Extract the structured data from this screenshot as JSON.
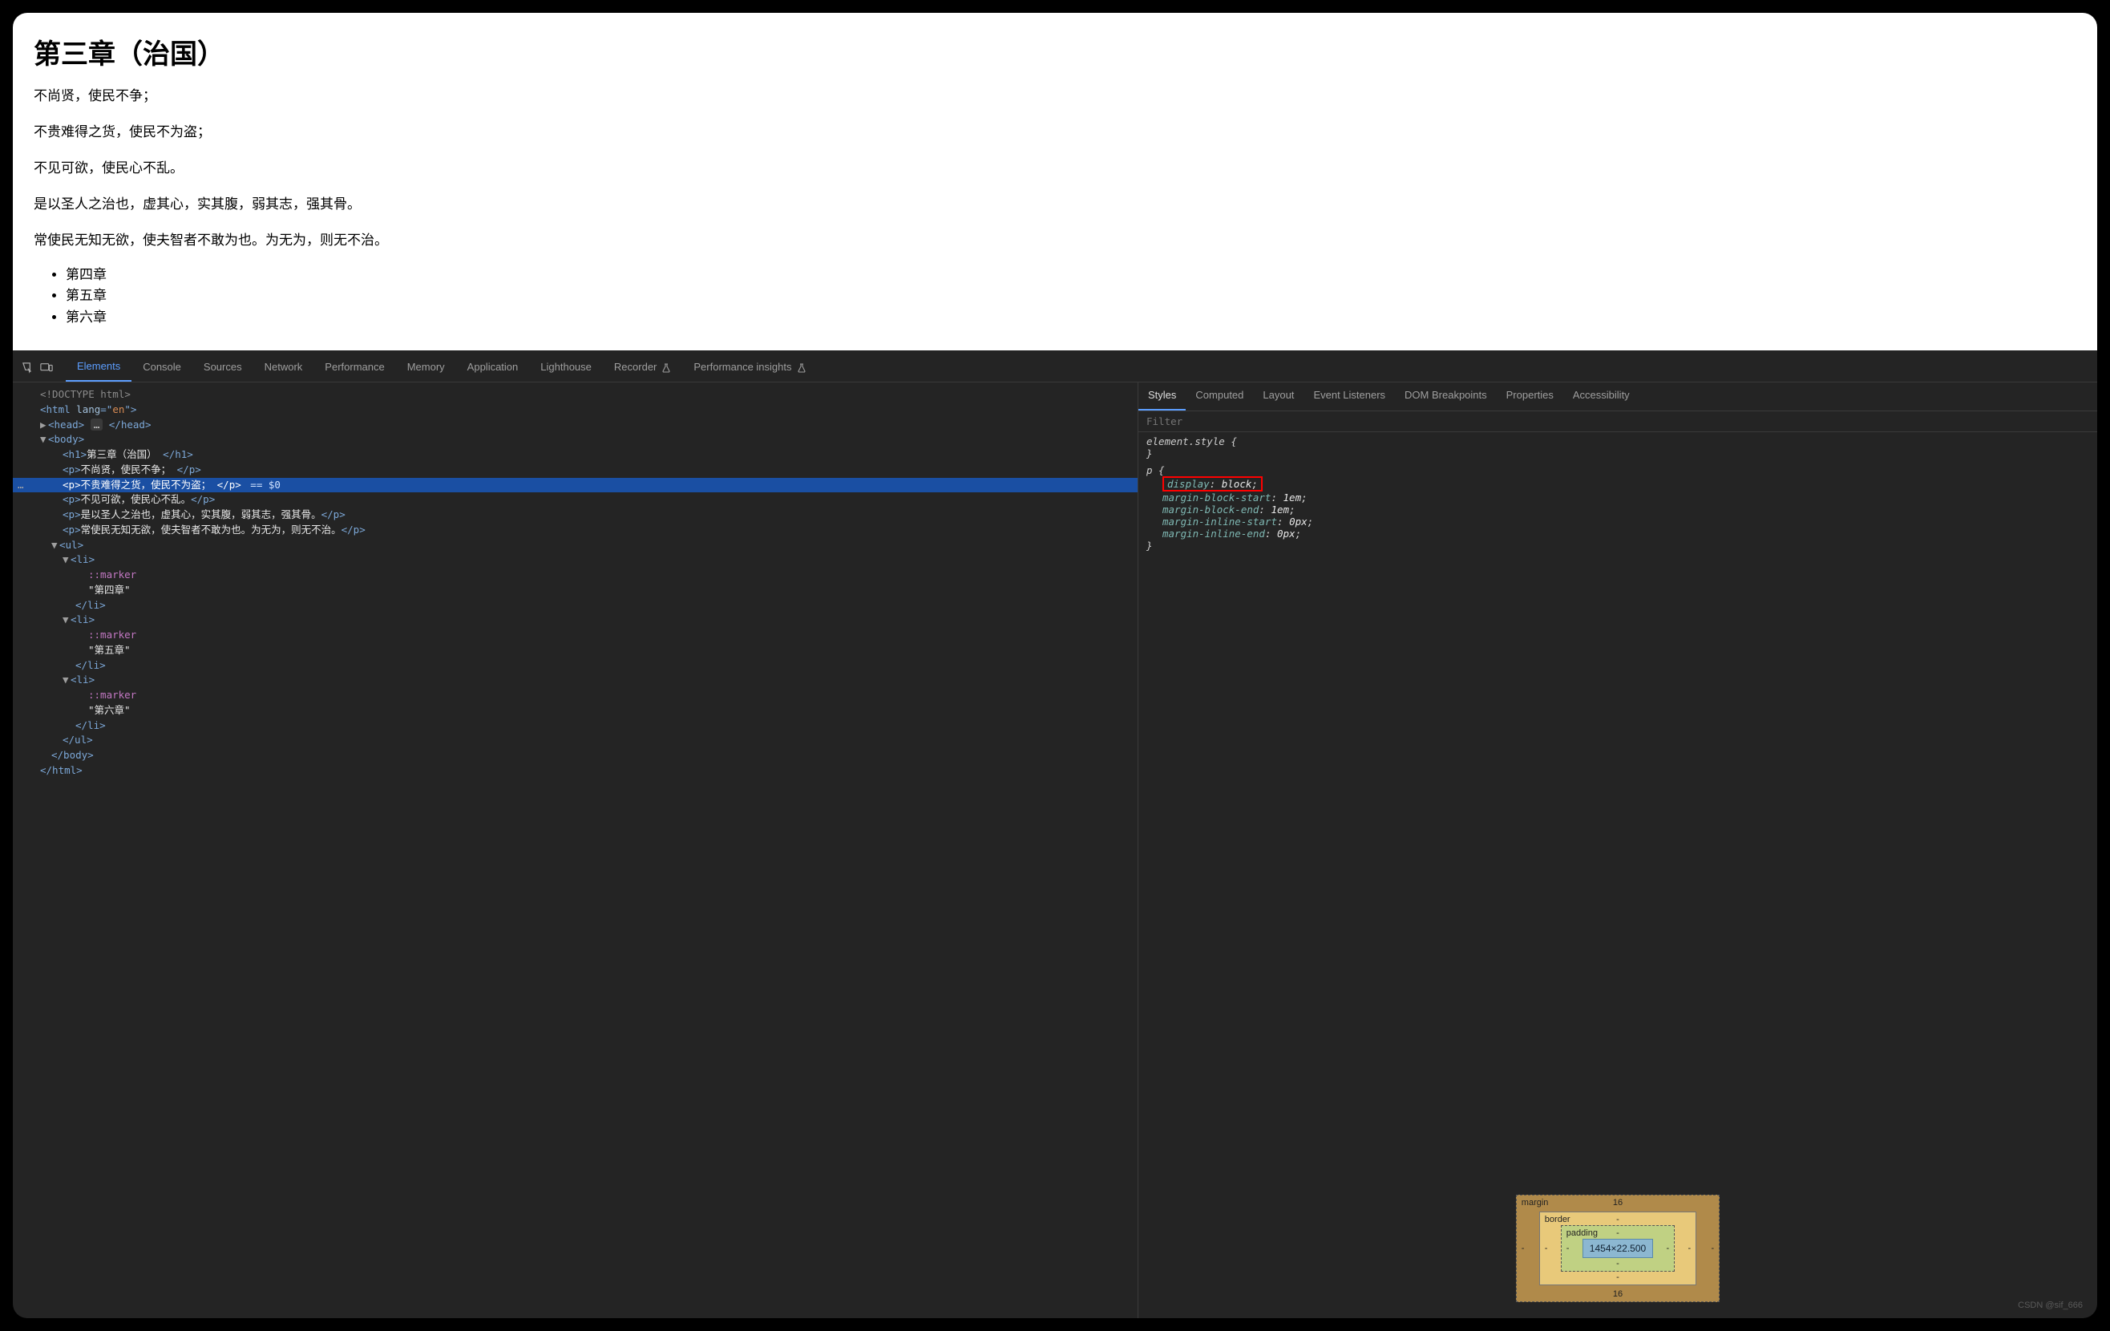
{
  "page": {
    "title": "第三章（治国）",
    "paragraphs": [
      "不尚贤，使民不争；",
      "不贵难得之货，使民不为盗；",
      "不见可欲，使民心不乱。",
      "是以圣人之治也，虚其心，实其腹，弱其志，强其骨。",
      "常使民无知无欲，使夫智者不敢为也。为无为，则无不治。"
    ],
    "list": [
      "第四章",
      "第五章",
      "第六章"
    ]
  },
  "devtools": {
    "tabs": [
      "Elements",
      "Console",
      "Sources",
      "Network",
      "Performance",
      "Memory",
      "Application",
      "Lighthouse",
      "Recorder",
      "Performance insights"
    ],
    "activeTab": "Elements",
    "tree": {
      "doctype": "<!DOCTYPE html>",
      "html_open": "html",
      "lang_attr": "lang",
      "lang_val": "en",
      "head_open": "head",
      "head_ellipsis": "…",
      "head_close": "/head",
      "body_open": "body",
      "h1_open": "h1",
      "h1_text": "第三章（治国）",
      "h1_close": "/h1",
      "p_tag": "p",
      "p_close": "/p",
      "p1": "不尚贤，使民不争；",
      "p2": "不贵难得之货，使民不为盗；",
      "p3": "不见可欲，使民心不乱。",
      "p4": "是以圣人之治也，虚其心，实其腹，弱其志，强其骨。",
      "p5": "常使民无知无欲，使夫智者不敢为也。为无为，则无不治。",
      "eq0": " == $0",
      "ul_open": "ul",
      "li_open": "li",
      "marker": "::marker",
      "li1_text": "\"第四章\"",
      "li2_text": "\"第五章\"",
      "li3_text": "\"第六章\"",
      "li_close": "/li",
      "ul_close": "/ul",
      "body_close": "/body",
      "html_close": "/html"
    },
    "styles": {
      "subtabs": [
        "Styles",
        "Computed",
        "Layout",
        "Event Listeners",
        "DOM Breakpoints",
        "Properties",
        "Accessibility"
      ],
      "activeSubtab": "Styles",
      "filter_placeholder": "Filter",
      "elstyle_sel": "element.style",
      "brace_open": " {",
      "brace_close": "}",
      "p_sel": "p",
      "p_props": [
        {
          "n": "display",
          "v": "block",
          "hl": true
        },
        {
          "n": "margin-block-start",
          "v": "1em"
        },
        {
          "n": "margin-block-end",
          "v": "1em"
        },
        {
          "n": "margin-inline-start",
          "v": "0px"
        },
        {
          "n": "margin-inline-end",
          "v": "0px"
        }
      ],
      "box": {
        "margin_label": "margin",
        "margin_top": "16",
        "margin_bottom": "16",
        "margin_left": "-",
        "margin_right": "-",
        "border_label": "border",
        "dash": "-",
        "padding_label": "padding",
        "content": "1454×22.500"
      }
    }
  },
  "watermark": "CSDN @sif_666"
}
